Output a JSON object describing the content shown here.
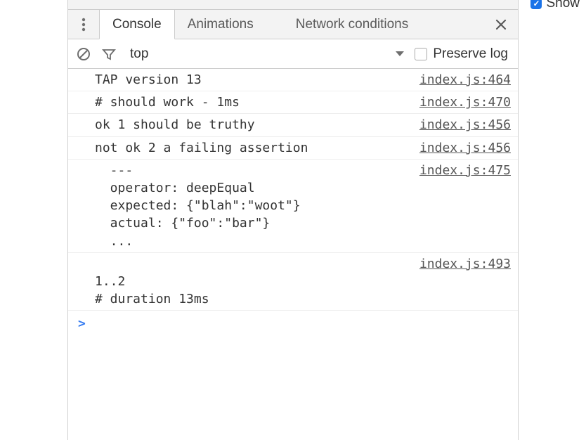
{
  "header": {
    "show_label_fragment": "Show"
  },
  "tabs": {
    "items": [
      {
        "label": "Console",
        "active": true
      },
      {
        "label": "Animations",
        "active": false
      },
      {
        "label": "Network conditions",
        "active": false
      }
    ]
  },
  "toolbar": {
    "context_label": "top",
    "preserve_log_label": "Preserve log",
    "preserve_log_checked": false
  },
  "icons": {
    "kebab": "kebab-icon",
    "clear": "clear-icon",
    "filter": "filter-icon",
    "caret_down": "caret-down-icon",
    "close": "close-icon",
    "checkmark": "checkmark-icon"
  },
  "log": {
    "rows": [
      {
        "message": "TAP version 13",
        "source": "index.js:464"
      },
      {
        "message": "# should work - 1ms",
        "source": "index.js:470"
      },
      {
        "message": "ok 1 should be truthy",
        "source": "index.js:456"
      },
      {
        "message": "not ok 2 a failing assertion",
        "source": "index.js:456"
      },
      {
        "message": "  ---\n  operator: deepEqual\n  expected: {\"blah\":\"woot\"}\n  actual: {\"foo\":\"bar\"}\n  ...",
        "source": "index.js:475"
      },
      {
        "message": "\n1..2\n# duration 13ms",
        "source": "index.js:493"
      }
    ]
  },
  "prompt": {
    "symbol": ">"
  }
}
